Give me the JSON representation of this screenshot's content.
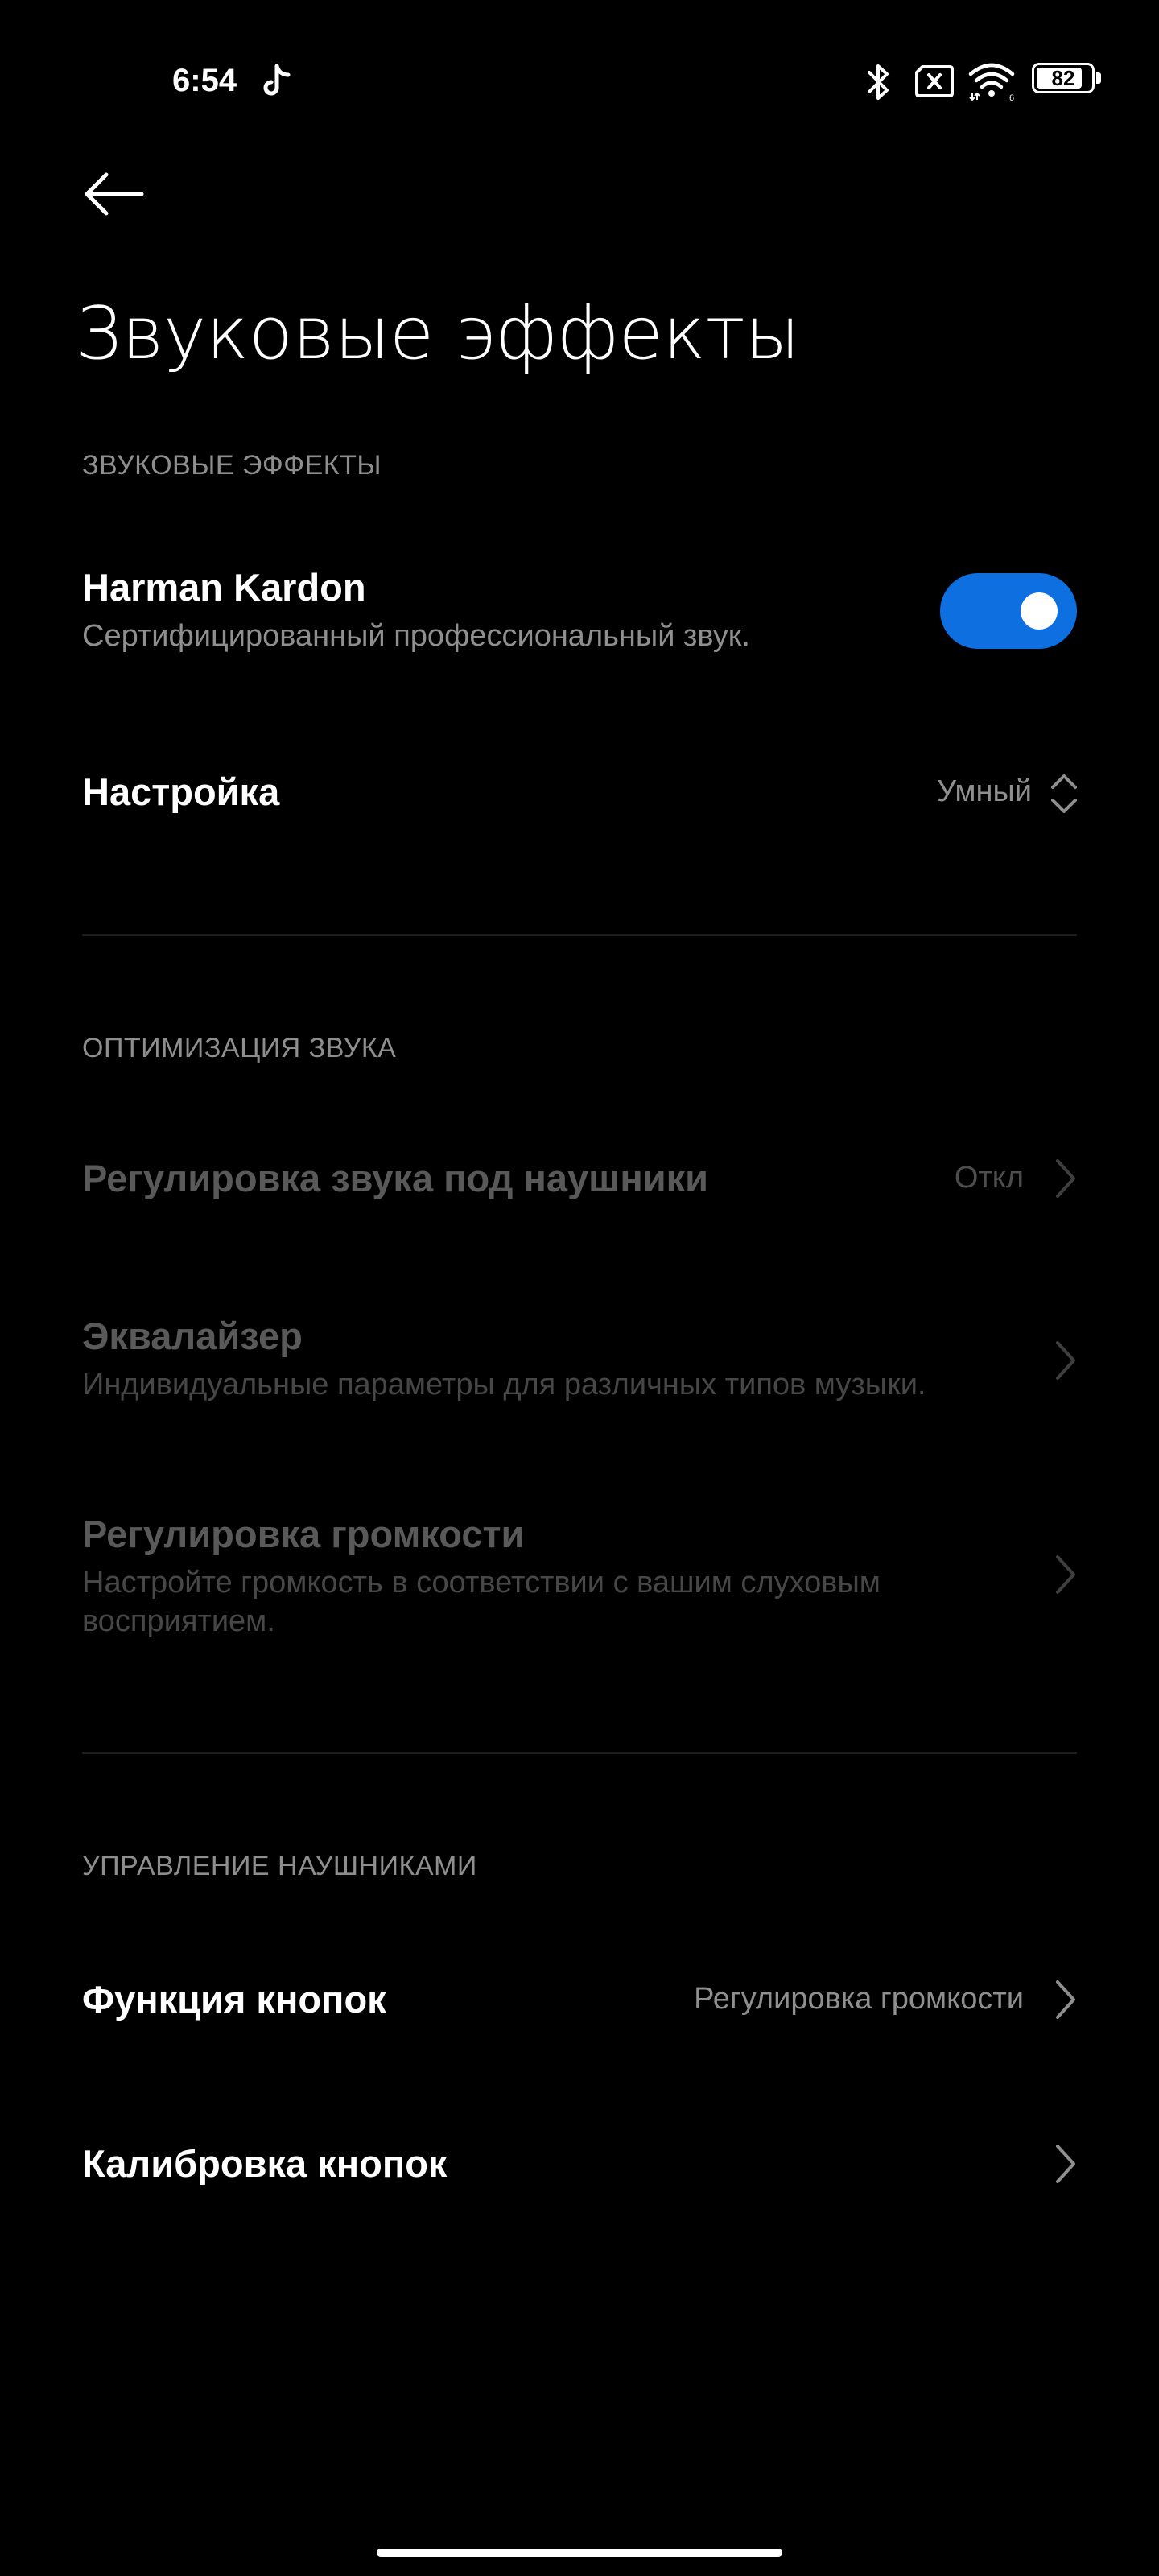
{
  "status_bar": {
    "time": "6:54",
    "battery": "82",
    "icons": [
      "tiktok-icon",
      "bluetooth-icon",
      "sim-off-icon",
      "wifi-icon",
      "battery-icon"
    ]
  },
  "header": {
    "back_icon": "back-arrow-icon",
    "title": "Звуковые эффекты"
  },
  "sections": {
    "sound_effects": {
      "header": "ЗВУКОВЫЕ ЭФФЕКТЫ",
      "harman": {
        "title": "Harman Kardon",
        "subtitle": "Сертифицированный профессиональный звук.",
        "enabled": true
      },
      "setting": {
        "title": "Настройка",
        "value": "Умный"
      }
    },
    "optimization": {
      "header": "ОПТИМИЗАЦИЯ ЗВУКА",
      "headphones_adjust": {
        "title": "Регулировка звука под наушники",
        "value": "Откл"
      },
      "equalizer": {
        "title": "Эквалайзер",
        "subtitle": "Индивидуальные параметры для различных типов музыки."
      },
      "volume_adjust": {
        "title": "Регулировка громкости",
        "subtitle": "Настройте громкость в соответствии с вашим слуховым восприятием."
      }
    },
    "headphone_control": {
      "header": "УПРАВЛЕНИЕ НАУШНИКАМИ",
      "button_function": {
        "title": "Функция кнопок",
        "value": "Регулировка громкости"
      },
      "button_calibration": {
        "title": "Калибровка кнопок"
      }
    }
  },
  "colors": {
    "background": "#000000",
    "accent": "#0d6fe0",
    "secondary_text": "#8f8f8f",
    "disabled_text": "#595959"
  }
}
